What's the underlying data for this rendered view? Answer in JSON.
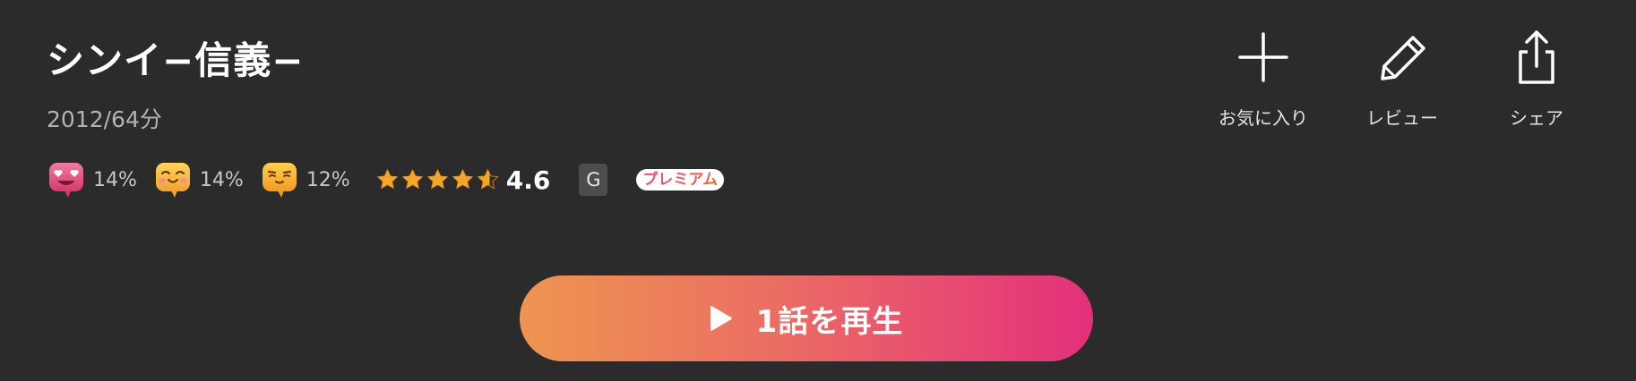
{
  "title": "シンイ−信義−",
  "meta": "2012/64分",
  "reactions": [
    {
      "icon": "heart-eyes-emoji-icon",
      "percent": "14%",
      "color": "#e8507a"
    },
    {
      "icon": "blushing-smile-emoji-icon",
      "percent": "14%",
      "color": "#f3b23a"
    },
    {
      "icon": "content-smile-emoji-icon",
      "percent": "12%",
      "color": "#f4a62a"
    }
  ],
  "rating": {
    "value": "4.6",
    "stars": 4.6,
    "star_color": "#f5a623"
  },
  "age_rating": "G",
  "premium_badge": "プレミアム",
  "actions": {
    "favorite": {
      "label": "お気に入り",
      "icon": "plus-icon"
    },
    "review": {
      "label": "レビュー",
      "icon": "pencil-icon"
    },
    "share": {
      "label": "シェア",
      "icon": "share-icon"
    }
  },
  "play_button": {
    "label": "1話を再生",
    "icon": "play-icon",
    "gradient": [
      "#ee9550",
      "#e3307b"
    ]
  }
}
